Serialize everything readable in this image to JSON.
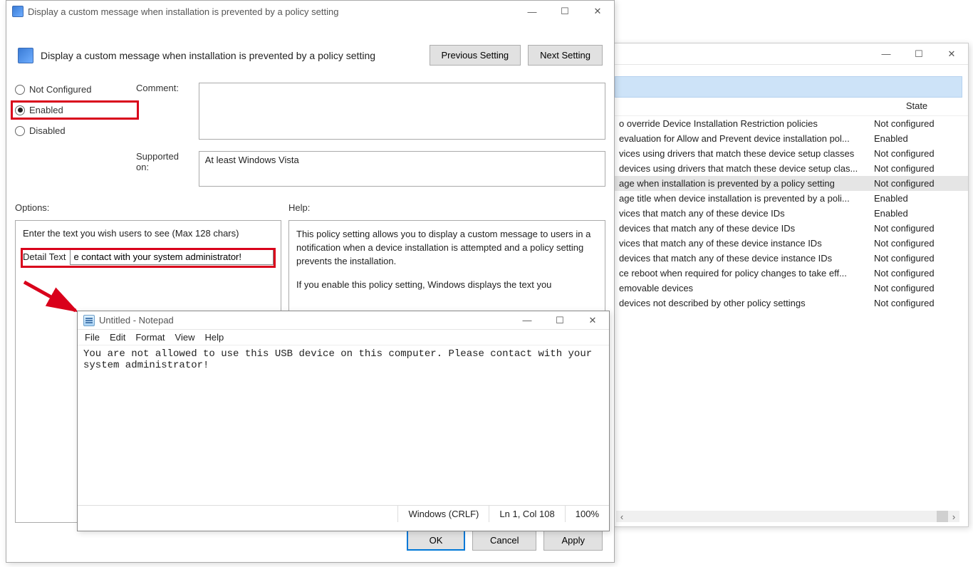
{
  "bgwin": {
    "winbtns": {
      "min": "—",
      "max": "☐",
      "close": "✕"
    },
    "headers": {
      "state": "State"
    },
    "rows": [
      {
        "name": "o override Device Installation Restriction policies",
        "state": "Not configured"
      },
      {
        "name": "evaluation for Allow and Prevent device installation pol...",
        "state": "Enabled"
      },
      {
        "name": "vices using drivers that match these device setup classes",
        "state": "Not configured"
      },
      {
        "name": "devices using drivers that match these device setup clas...",
        "state": "Not configured"
      },
      {
        "name": "age when installation is prevented by a policy setting",
        "state": "Not configured",
        "sel": true
      },
      {
        "name": "age title when device installation is prevented by a poli...",
        "state": "Enabled"
      },
      {
        "name": "vices that match any of these device IDs",
        "state": "Enabled"
      },
      {
        "name": "devices that match any of these device IDs",
        "state": "Not configured"
      },
      {
        "name": "vices that match any of these device instance IDs",
        "state": "Not configured"
      },
      {
        "name": "devices that match any of these device instance IDs",
        "state": "Not configured"
      },
      {
        "name": "ce reboot when required for policy changes to take eff...",
        "state": "Not configured"
      },
      {
        "name": "emovable devices",
        "state": "Not configured"
      },
      {
        "name": "devices not described by other policy settings",
        "state": "Not configured"
      }
    ]
  },
  "dlg": {
    "title": "Display a custom message when installation is prevented by a policy setting",
    "winbtns": {
      "min": "—",
      "max": "☐",
      "close": "✕"
    },
    "heading": "Display a custom message when installation is prevented by a policy setting",
    "prev": "Previous Setting",
    "next": "Next Setting",
    "radios": {
      "notconf": "Not Configured",
      "enabled": "Enabled",
      "disabled": "Disabled"
    },
    "comment_label": "Comment:",
    "comment_value": "",
    "supported_label": "Supported on:",
    "supported_value": "At least Windows Vista",
    "options_label": "Options:",
    "help_label": "Help:",
    "options_hint": "Enter the text you wish users to see (Max 128 chars)",
    "detail_label": "Detail Text",
    "detail_value": "e contact with your system administrator!",
    "help_p1": "This policy setting allows you to display a custom message to users in a notification when a device installation is attempted and a policy setting prevents the installation.",
    "help_p2": "If you enable this policy setting, Windows displays the text you",
    "ok": "OK",
    "cancel": "Cancel",
    "apply": "Apply"
  },
  "np": {
    "title": "Untitled - Notepad",
    "winbtns": {
      "min": "—",
      "max": "☐",
      "close": "✕"
    },
    "menu": [
      "File",
      "Edit",
      "Format",
      "View",
      "Help"
    ],
    "content": "You are not allowed to use this USB device on this computer. Please contact with your system administrator!",
    "status": {
      "enc": "Windows (CRLF)",
      "pos": "Ln 1, Col 108",
      "zoom": "100%"
    }
  }
}
